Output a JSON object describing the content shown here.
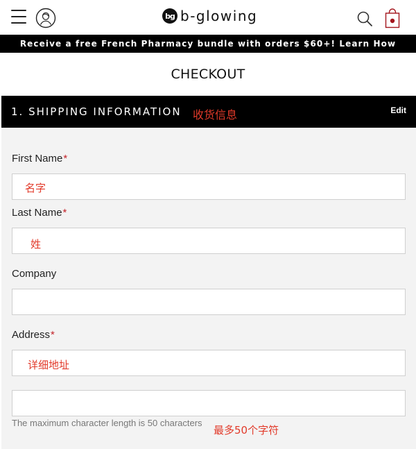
{
  "header": {
    "logo_mark": "bg",
    "logo_text": "b-glowing",
    "icons": [
      "menu-icon",
      "account-icon",
      "search-icon",
      "cart-icon"
    ],
    "cart_dot_color": "#a3141c"
  },
  "promo": {
    "text": "Receive a free French Pharmacy bundle with orders $60+! Learn How"
  },
  "page": {
    "title": "CHECKOUT"
  },
  "section": {
    "title": "1. SHIPPING INFORMATION",
    "note": "收货信息",
    "edit_label": "Edit"
  },
  "form": {
    "first_name": {
      "label": "First Name",
      "required": "*",
      "value": "",
      "annotation": "名字"
    },
    "last_name": {
      "label": "Last Name",
      "required": "*",
      "value": "",
      "annotation": "姓"
    },
    "company": {
      "label": "Company",
      "value": ""
    },
    "address": {
      "label": "Address",
      "required": "*",
      "value": "",
      "annotation": "详细地址"
    },
    "address2": {
      "value": ""
    },
    "hint": "The maximum character length is 50 characters",
    "hint_annotation": "最多50个字符"
  },
  "colors": {
    "annotation": "#e23a2a",
    "required": "#c3242a",
    "bar": "#000000",
    "form_bg": "#f3f3f3"
  }
}
